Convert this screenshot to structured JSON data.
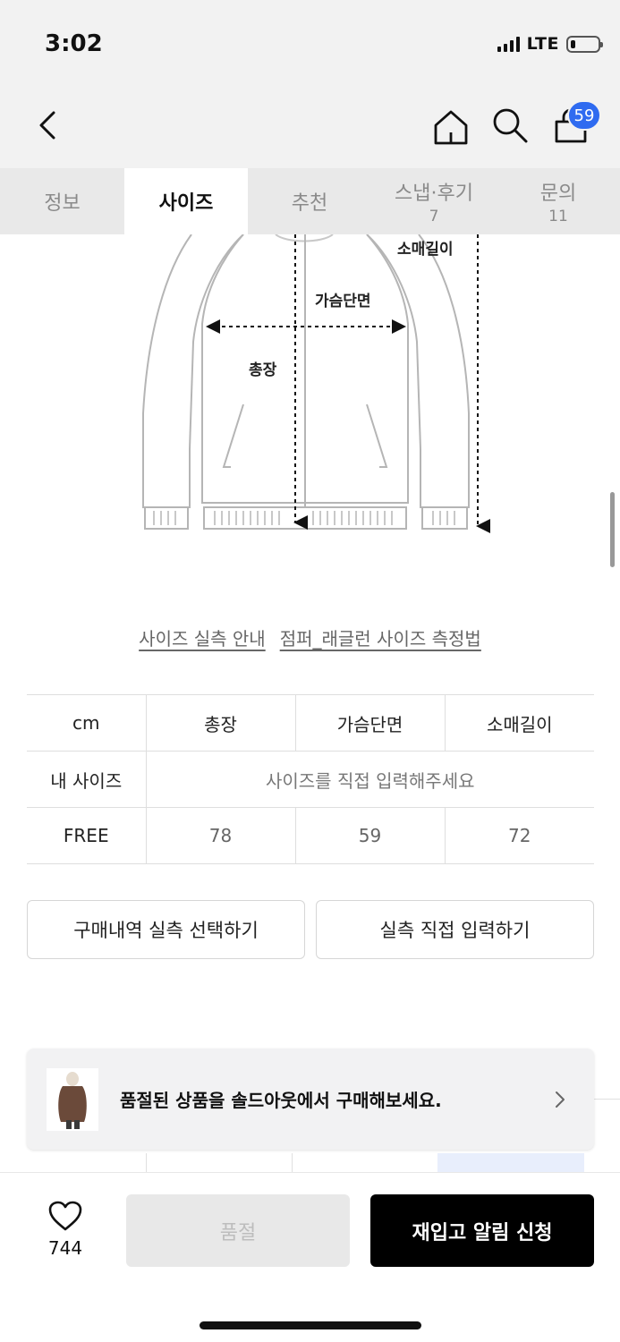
{
  "status_bar": {
    "time": "3:02",
    "network": "LTE",
    "battery_level_percent": 15
  },
  "nav": {
    "cart_count": "59",
    "icons": [
      "chevron-left-icon",
      "home-icon",
      "search-icon",
      "shopping-bag-icon"
    ]
  },
  "tabs": [
    {
      "label": "정보",
      "count": "",
      "active": false
    },
    {
      "label": "사이즈",
      "count": "",
      "active": true
    },
    {
      "label": "추천",
      "count": "",
      "active": false
    },
    {
      "label": "스냅·후기",
      "count": "7",
      "active": false
    },
    {
      "label": "문의",
      "count": "11",
      "active": false
    }
  ],
  "diagram": {
    "labels": {
      "sleeve": "소매길이",
      "chest": "가슴단면",
      "length": "총장"
    }
  },
  "links": {
    "size_guide": "사이즈 실측 안내",
    "measure_method": "점퍼_래글런 사이즈 측정법"
  },
  "size_table": {
    "headers": [
      "cm",
      "총장",
      "가슴단면",
      "소매길이"
    ],
    "my_size": {
      "label": "내 사이즈",
      "placeholder": "사이즈를 직접 입력해주세요"
    },
    "rows": [
      {
        "size": "FREE",
        "values": [
          "78",
          "59",
          "72"
        ]
      }
    ]
  },
  "buttons": {
    "select_from_purchases": "구매내역 실측 선택하기",
    "enter_manually": "실측 직접 입력하기"
  },
  "banner": {
    "text": "품절된 상품을 솔드아웃에서 구매해보세요."
  },
  "bottom_bar": {
    "like_count": "744",
    "soldout_label": "품절",
    "restock_label": "재입고 알림 신청"
  },
  "colors": {
    "badge": "#2f6bf0",
    "primary_button": "#000000",
    "disabled_button": "#e8e8e8",
    "header_background": "#f2f2f2"
  }
}
